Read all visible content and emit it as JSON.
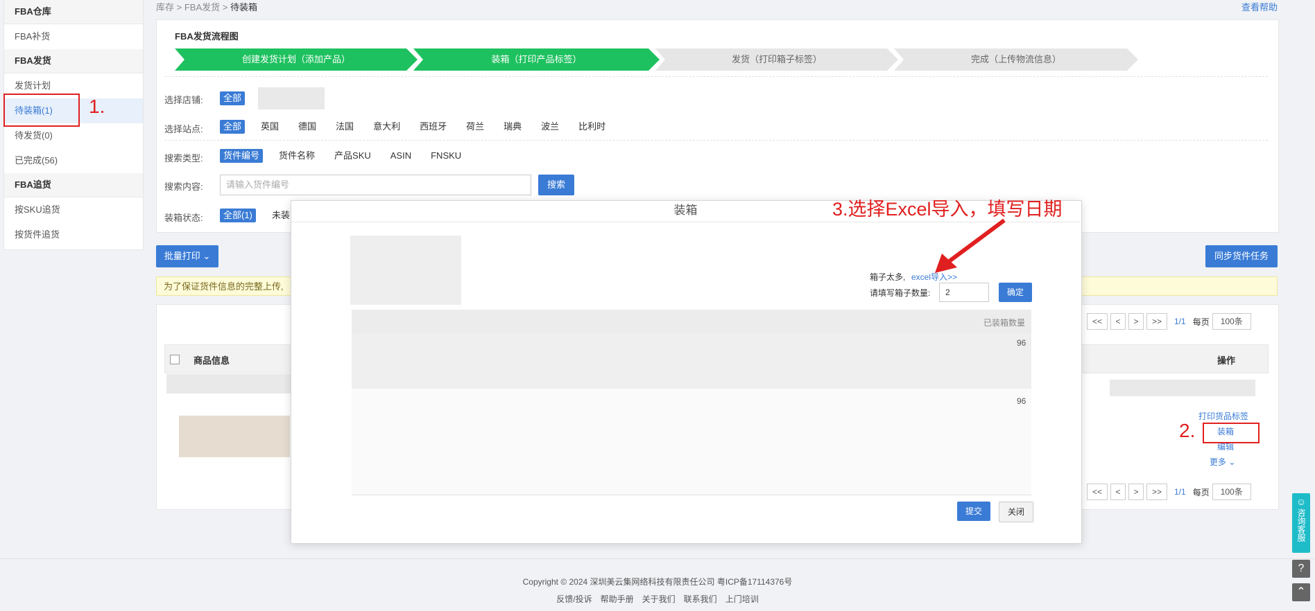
{
  "sidebar": {
    "groups": [
      {
        "title": "FBA仓库",
        "items": [
          "FBA补货"
        ]
      },
      {
        "title": "FBA发货",
        "items": [
          "发货计划",
          "待装箱(1)",
          "待发货(0)",
          "已完成(56)"
        ]
      },
      {
        "title": "FBA追货",
        "items": [
          "按SKU追货",
          "按货件追货"
        ]
      }
    ]
  },
  "annotations": {
    "step1": "1.",
    "step2": "2.",
    "step3": "3.选择Excel导入，填写日期"
  },
  "breadcrumb": [
    "库存",
    "FBA发货",
    "待装箱"
  ],
  "help_link": "查看帮助",
  "flow": {
    "title": "FBA发货流程图",
    "steps": [
      {
        "label": "创建发货计划（添加产品）",
        "done": true
      },
      {
        "label": "装箱（打印产品标签）",
        "done": true
      },
      {
        "label": "发货（打印箱子标签）",
        "done": false
      },
      {
        "label": "完成（上传物流信息）",
        "done": false
      }
    ]
  },
  "filters": {
    "store_label": "选择店铺:",
    "store_all": "全部",
    "site_label": "选择站点:",
    "sites": [
      "全部",
      "英国",
      "德国",
      "法国",
      "意大利",
      "西班牙",
      "荷兰",
      "瑞典",
      "波兰",
      "比利时"
    ],
    "search_type_label": "搜索类型:",
    "search_types": [
      "货件编号",
      "货件名称",
      "产品SKU",
      "ASIN",
      "FNSKU"
    ],
    "search_content_label": "搜索内容:",
    "search_placeholder": "请输入货件编号",
    "search_button": "搜索",
    "status_label": "装箱状态:",
    "statuses": [
      "全部(1)",
      "未装"
    ]
  },
  "toolbar": {
    "batch_print": "批量打印",
    "sync_button": "同步货件任务"
  },
  "warning_text": "为了保证货件信息的完整上传,",
  "table": {
    "col_product": "商品信息",
    "col_action": "操作",
    "actions": [
      "打印货品标签",
      "装箱",
      "编辑",
      "更多"
    ]
  },
  "pager": {
    "buttons": [
      "<<",
      "<",
      ">",
      ">>"
    ],
    "page": "1/1",
    "per_page_label": "每页",
    "per_page_value": "100条"
  },
  "modal": {
    "title": "装箱",
    "too_many_text": "箱子太多,",
    "excel_link": "excel导入>>",
    "box_count_label": "请填写箱子数量:",
    "box_count_value": "2",
    "confirm_button": "确定",
    "packed_header": "已装箱数量",
    "row_values": [
      "96",
      "96"
    ],
    "submit_button": "提交",
    "close_button": "关闭"
  },
  "footer": {
    "copyright": "Copyright © 2024 深圳美云集网络科技有限责任公司  粤ICP备17114376号",
    "links": [
      "反馈/投诉",
      "帮助手册",
      "关于我们",
      "联系我们",
      "上门培训"
    ]
  },
  "float": {
    "service_label": "咨询客服"
  },
  "colors": {
    "primary": "#3a7bd5",
    "step_done": "#1ec15f",
    "annotation": "#e02020"
  }
}
